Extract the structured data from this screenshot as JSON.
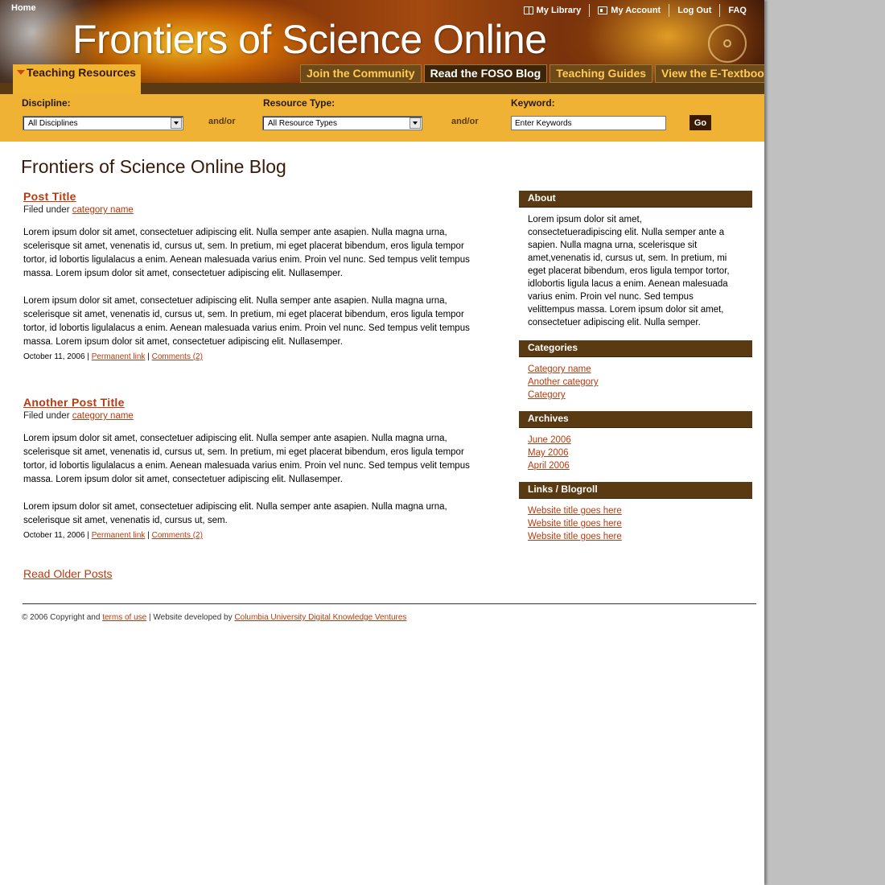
{
  "header": {
    "home": "Home",
    "title": "Frontiers of Science Online",
    "top_nav": [
      "My Library",
      "My Account",
      "Log Out",
      "FAQ"
    ],
    "active_tab": "Teaching Resources",
    "tabs": [
      "Join the Community",
      "Read the FOSO Blog",
      "Teaching Guides",
      "View the E-Textbook"
    ]
  },
  "search": {
    "discipline_label": "Discipline:",
    "discipline_value": "All Disciplines",
    "andor_1": "and/or",
    "resource_label": "Resource Type:",
    "resource_value": "All Resource Types",
    "andor_2": "and/or",
    "keyword_label": "Keyword:",
    "keyword_value": "Enter Keywords",
    "go": "Go"
  },
  "blog_title": "Frontiers of Science Online Blog",
  "posts": [
    {
      "title": "Post Title",
      "filed_prefix": "Filed under",
      "category": "category name",
      "paragraphs": [
        "Lorem ipsum dolor sit amet, consectetuer adipiscing elit. Nulla semper ante asapien. Nulla magna urna, scelerisque sit amet, venenatis id, cursus ut, sem. In pretium, mi eget placerat bibendum, eros ligula tempor tortor, id lobortis ligulalacus a enim. Aenean malesuada varius enim. Proin vel nunc. Sed tempus velit tempus massa.  Lorem ipsum dolor sit amet, consectetuer adipiscing elit. Nullasemper.",
        "Lorem ipsum dolor sit amet, consectetuer adipiscing elit. Nulla semper ante asapien. Nulla magna urna, scelerisque sit amet, venenatis id, cursus ut, sem. In pretium, mi eget placerat bibendum, eros ligula tempor tortor, id lobortis ligulalacus a enim. Aenean malesuada varius enim. Proin vel nunc. Sed tempus velit tempus massa.  Lorem ipsum dolor sit amet, consectetuer adipiscing elit. Nullasemper."
      ],
      "date": "October 11, 2006",
      "sep": "|",
      "permalink": "Permanent link",
      "comments": "Comments (2)"
    },
    {
      "title": "Another Post Title",
      "filed_prefix": "Filed under",
      "category": "category name",
      "paragraphs": [
        "Lorem ipsum dolor sit amet, consectetuer adipiscing elit. Nulla semper ante asapien. Nulla magna urna, scelerisque sit amet, venenatis id, cursus ut, sem. In pretium, mi eget placerat bibendum, eros ligula tempor tortor, id lobortis ligulalacus a enim. Aenean malesuada varius enim. Proin vel nunc. Sed tempus velit tempus massa.  Lorem ipsum dolor sit amet, consectetuer adipiscing elit. Nullasemper.",
        "Lorem ipsum dolor sit amet, consectetuer adipiscing elit. Nulla semper ante asapien. Nulla magna urna, scelerisque sit amet, venenatis id, cursus ut, sem."
      ],
      "date": "October 11, 2006",
      "sep": "|",
      "permalink": "Permanent link",
      "comments": "Comments (2)"
    }
  ],
  "read_older": "Read Older Posts",
  "sidebar": {
    "about_title": "About",
    "about_text": "Lorem ipsum dolor sit amet, consectetueradipiscing elit. Nulla semper ante a sapien. Nulla magna urna, scelerisque sit amet,venenatis id, cursus ut, sem. In pretium, mi eget placerat bibendum, eros ligula tempor tortor, idlobortis ligula lacus a enim. Aenean malesuada varius enim. Proin vel nunc. Sed tempus velittempus massa.  Lorem ipsum dolor sit amet, consectetuer adipiscing elit. Nulla semper.",
    "categories_title": "Categories",
    "categories": [
      "Category name",
      "Another category",
      "Category"
    ],
    "archives_title": "Archives",
    "archives": [
      "June 2006",
      "May 2006",
      "April 2006"
    ],
    "links_title": "Links / Blogroll",
    "links": [
      "Website title goes here",
      "Website title goes here",
      "Website title goes here"
    ]
  },
  "footer": {
    "copyright": "© 2006 Copyright and",
    "terms": "terms of use",
    "developed": "| Website developed by",
    "developer": "Columbia University Digital Knowledge Ventures"
  }
}
